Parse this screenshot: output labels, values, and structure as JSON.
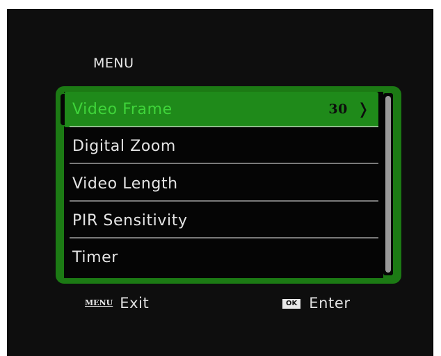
{
  "menu": {
    "title": "MENU",
    "items": [
      {
        "label": "Video Frame",
        "value": "30",
        "selected": true
      },
      {
        "label": "Digital Zoom"
      },
      {
        "label": "Video Length"
      },
      {
        "label": "PIR Sensitivity"
      },
      {
        "label": "Timer"
      }
    ]
  },
  "footer": {
    "exit_key": "MENU",
    "exit_label": "Exit",
    "enter_key": "OK",
    "enter_label": "Enter"
  },
  "colors": {
    "panel_green": "#1c7a14",
    "selected_green": "#1f8a1a",
    "background": "#0e0e0e"
  },
  "icons": [
    "chevron-right-icon"
  ]
}
